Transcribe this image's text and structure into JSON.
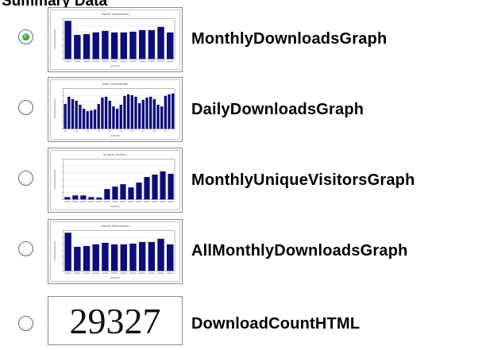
{
  "header": {
    "title": "Summary Data"
  },
  "options": [
    {
      "label": "MonthlyDownloadsGraph",
      "checked": true,
      "thumbnail": {
        "kind": "bar-graph",
        "title": "Month Downloads",
        "bar_color": "#0d0d7a",
        "values": [
          95,
          60,
          62,
          66,
          70,
          66,
          66,
          68,
          72,
          72,
          80,
          66
        ]
      }
    },
    {
      "label": "DailyDownloadsGraph",
      "checked": false,
      "thumbnail": {
        "kind": "bar-graph",
        "title": "Daily Downloads",
        "bar_color": "#0d0d7a",
        "values": [
          62,
          80,
          74,
          70,
          60,
          50,
          44,
          46,
          48,
          62,
          78,
          80,
          70,
          56,
          50,
          60,
          82,
          86,
          84,
          80,
          64,
          72,
          78,
          80,
          74,
          60,
          56,
          82,
          86,
          88
        ]
      }
    },
    {
      "label": "MonthlyUniqueVisitorsGraph",
      "checked": false,
      "thumbnail": {
        "kind": "bar-graph",
        "title": "Unique Visitors",
        "bar_color": "#0d0d7a",
        "values": [
          6,
          10,
          10,
          6,
          5,
          26,
          32,
          38,
          30,
          42,
          56,
          62,
          70,
          64
        ]
      }
    },
    {
      "label": "AllMonthlyDownloadsGraph",
      "checked": false,
      "thumbnail": {
        "kind": "bar-graph",
        "title": "Month Downloads",
        "bar_color": "#0d0d7a",
        "values": [
          95,
          60,
          62,
          66,
          70,
          66,
          66,
          68,
          72,
          72,
          80,
          66
        ]
      }
    },
    {
      "label": "DownloadCountHTML",
      "checked": false,
      "thumbnail": {
        "kind": "number",
        "value": "29327"
      }
    }
  ]
}
